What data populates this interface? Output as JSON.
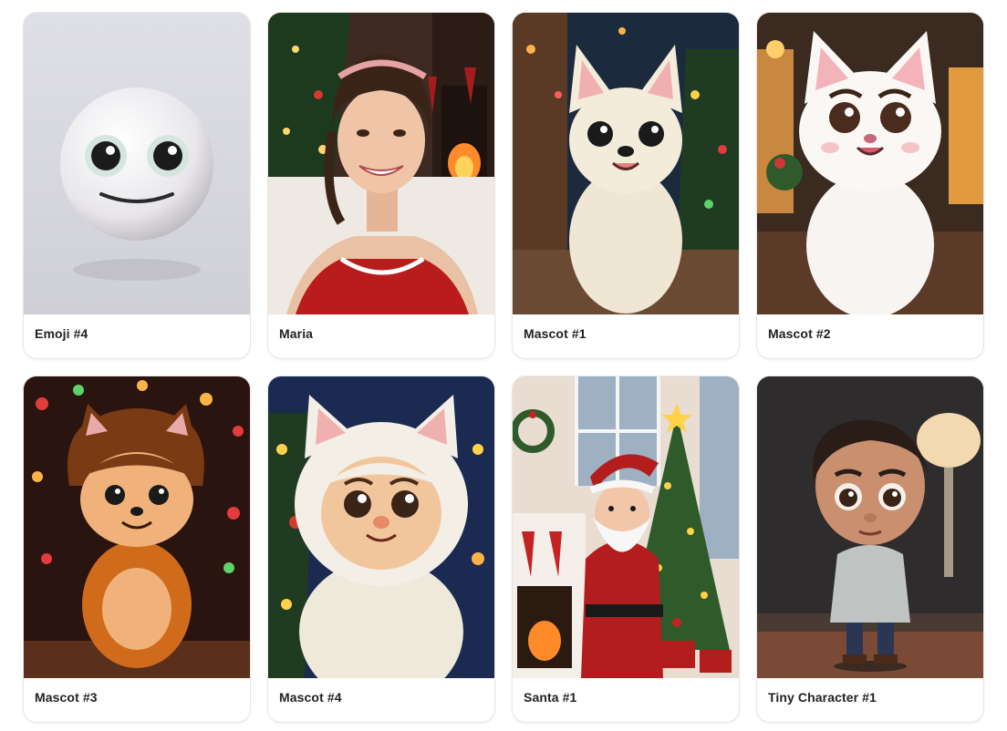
{
  "gallery": {
    "items": [
      {
        "label": "Emoji #4",
        "icon": "emoji-face"
      },
      {
        "label": "Maria",
        "icon": "portrait-woman"
      },
      {
        "label": "Mascot #1",
        "icon": "mascot-white-dog"
      },
      {
        "label": "Mascot #2",
        "icon": "mascot-white-cat"
      },
      {
        "label": "Mascot #3",
        "icon": "mascot-brown-fox"
      },
      {
        "label": "Mascot #4",
        "icon": "mascot-fluffy-baby"
      },
      {
        "label": "Santa #1",
        "icon": "santa-claus"
      },
      {
        "label": "Tiny Character #1",
        "icon": "tiny-boy"
      }
    ]
  },
  "colors": {
    "card_border": "#e6e6e6",
    "label_text": "#222222"
  }
}
